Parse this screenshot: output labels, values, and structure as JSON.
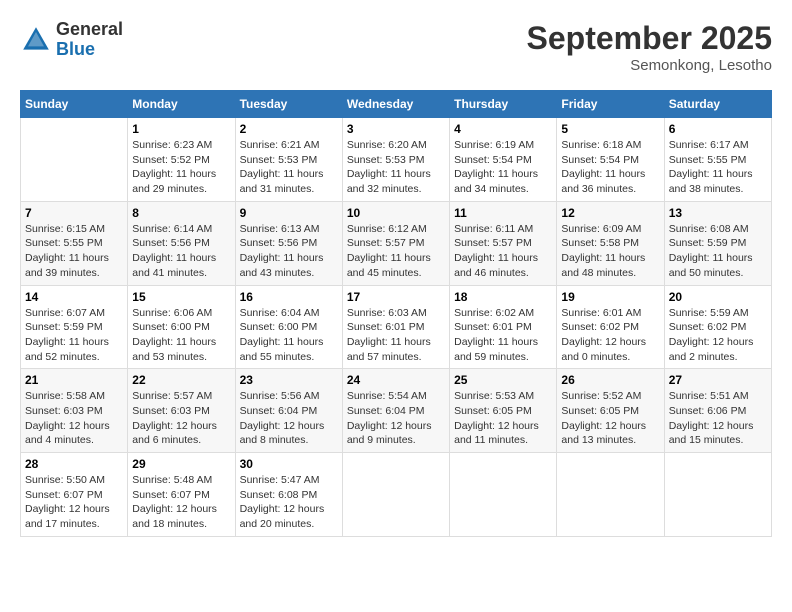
{
  "logo": {
    "general": "General",
    "blue": "Blue"
  },
  "title": "September 2025",
  "location": "Semonkong, Lesotho",
  "days_of_week": [
    "Sunday",
    "Monday",
    "Tuesday",
    "Wednesday",
    "Thursday",
    "Friday",
    "Saturday"
  ],
  "weeks": [
    [
      {
        "day": "",
        "info": ""
      },
      {
        "day": "1",
        "info": "Sunrise: 6:23 AM\nSunset: 5:52 PM\nDaylight: 11 hours\nand 29 minutes."
      },
      {
        "day": "2",
        "info": "Sunrise: 6:21 AM\nSunset: 5:53 PM\nDaylight: 11 hours\nand 31 minutes."
      },
      {
        "day": "3",
        "info": "Sunrise: 6:20 AM\nSunset: 5:53 PM\nDaylight: 11 hours\nand 32 minutes."
      },
      {
        "day": "4",
        "info": "Sunrise: 6:19 AM\nSunset: 5:54 PM\nDaylight: 11 hours\nand 34 minutes."
      },
      {
        "day": "5",
        "info": "Sunrise: 6:18 AM\nSunset: 5:54 PM\nDaylight: 11 hours\nand 36 minutes."
      },
      {
        "day": "6",
        "info": "Sunrise: 6:17 AM\nSunset: 5:55 PM\nDaylight: 11 hours\nand 38 minutes."
      }
    ],
    [
      {
        "day": "7",
        "info": "Sunrise: 6:15 AM\nSunset: 5:55 PM\nDaylight: 11 hours\nand 39 minutes."
      },
      {
        "day": "8",
        "info": "Sunrise: 6:14 AM\nSunset: 5:56 PM\nDaylight: 11 hours\nand 41 minutes."
      },
      {
        "day": "9",
        "info": "Sunrise: 6:13 AM\nSunset: 5:56 PM\nDaylight: 11 hours\nand 43 minutes."
      },
      {
        "day": "10",
        "info": "Sunrise: 6:12 AM\nSunset: 5:57 PM\nDaylight: 11 hours\nand 45 minutes."
      },
      {
        "day": "11",
        "info": "Sunrise: 6:11 AM\nSunset: 5:57 PM\nDaylight: 11 hours\nand 46 minutes."
      },
      {
        "day": "12",
        "info": "Sunrise: 6:09 AM\nSunset: 5:58 PM\nDaylight: 11 hours\nand 48 minutes."
      },
      {
        "day": "13",
        "info": "Sunrise: 6:08 AM\nSunset: 5:59 PM\nDaylight: 11 hours\nand 50 minutes."
      }
    ],
    [
      {
        "day": "14",
        "info": "Sunrise: 6:07 AM\nSunset: 5:59 PM\nDaylight: 11 hours\nand 52 minutes."
      },
      {
        "day": "15",
        "info": "Sunrise: 6:06 AM\nSunset: 6:00 PM\nDaylight: 11 hours\nand 53 minutes."
      },
      {
        "day": "16",
        "info": "Sunrise: 6:04 AM\nSunset: 6:00 PM\nDaylight: 11 hours\nand 55 minutes."
      },
      {
        "day": "17",
        "info": "Sunrise: 6:03 AM\nSunset: 6:01 PM\nDaylight: 11 hours\nand 57 minutes."
      },
      {
        "day": "18",
        "info": "Sunrise: 6:02 AM\nSunset: 6:01 PM\nDaylight: 11 hours\nand 59 minutes."
      },
      {
        "day": "19",
        "info": "Sunrise: 6:01 AM\nSunset: 6:02 PM\nDaylight: 12 hours\nand 0 minutes."
      },
      {
        "day": "20",
        "info": "Sunrise: 5:59 AM\nSunset: 6:02 PM\nDaylight: 12 hours\nand 2 minutes."
      }
    ],
    [
      {
        "day": "21",
        "info": "Sunrise: 5:58 AM\nSunset: 6:03 PM\nDaylight: 12 hours\nand 4 minutes."
      },
      {
        "day": "22",
        "info": "Sunrise: 5:57 AM\nSunset: 6:03 PM\nDaylight: 12 hours\nand 6 minutes."
      },
      {
        "day": "23",
        "info": "Sunrise: 5:56 AM\nSunset: 6:04 PM\nDaylight: 12 hours\nand 8 minutes."
      },
      {
        "day": "24",
        "info": "Sunrise: 5:54 AM\nSunset: 6:04 PM\nDaylight: 12 hours\nand 9 minutes."
      },
      {
        "day": "25",
        "info": "Sunrise: 5:53 AM\nSunset: 6:05 PM\nDaylight: 12 hours\nand 11 minutes."
      },
      {
        "day": "26",
        "info": "Sunrise: 5:52 AM\nSunset: 6:05 PM\nDaylight: 12 hours\nand 13 minutes."
      },
      {
        "day": "27",
        "info": "Sunrise: 5:51 AM\nSunset: 6:06 PM\nDaylight: 12 hours\nand 15 minutes."
      }
    ],
    [
      {
        "day": "28",
        "info": "Sunrise: 5:50 AM\nSunset: 6:07 PM\nDaylight: 12 hours\nand 17 minutes."
      },
      {
        "day": "29",
        "info": "Sunrise: 5:48 AM\nSunset: 6:07 PM\nDaylight: 12 hours\nand 18 minutes."
      },
      {
        "day": "30",
        "info": "Sunrise: 5:47 AM\nSunset: 6:08 PM\nDaylight: 12 hours\nand 20 minutes."
      },
      {
        "day": "",
        "info": ""
      },
      {
        "day": "",
        "info": ""
      },
      {
        "day": "",
        "info": ""
      },
      {
        "day": "",
        "info": ""
      }
    ]
  ]
}
